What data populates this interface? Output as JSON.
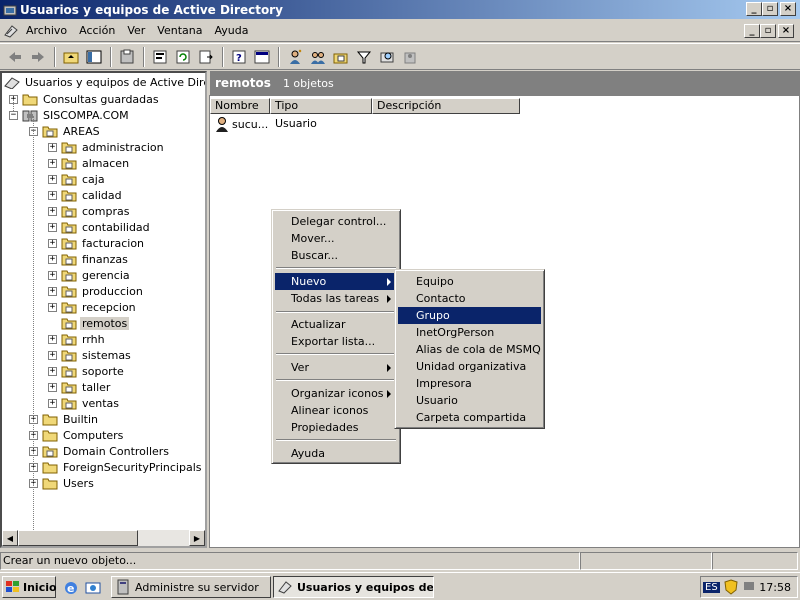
{
  "window": {
    "title": "Usuarios y equipos de Active Directory"
  },
  "menubar": {
    "items": [
      "Archivo",
      "Acción",
      "Ver",
      "Ventana",
      "Ayuda"
    ]
  },
  "toolbar": {
    "icons": [
      "back-icon",
      "forward-icon",
      "up-folder-icon",
      "show-tree-icon",
      "copy-icon",
      "properties-icon",
      "refresh-icon",
      "export-icon",
      "help-icon",
      "console-icon",
      "new-user-icon",
      "new-group-icon",
      "new-ou-icon",
      "filter-icon",
      "find-icon",
      "add-to-group-icon"
    ]
  },
  "tree": {
    "root": "Usuarios y equipos de Active Director",
    "saved_queries": "Consultas guardadas",
    "domain": "SISCOMPA.COM",
    "areas": "AREAS",
    "area_children": [
      "administracion",
      "almacen",
      "caja",
      "calidad",
      "compras",
      "contabilidad",
      "facturacion",
      "finanzas",
      "gerencia",
      "produccion",
      "recepcion",
      "remotos",
      "rrhh",
      "sistemas",
      "soporte",
      "taller",
      "ventas"
    ],
    "selected": "remotos",
    "domain_children": [
      "Builtin",
      "Computers",
      "Domain Controllers",
      "ForeignSecurityPrincipals",
      "Users"
    ]
  },
  "right_pane": {
    "header_title": "remotos",
    "header_count": "1 objetos",
    "columns": [
      "Nombre",
      "Tipo",
      "Descripción"
    ],
    "rows": [
      {
        "name": "sucu...",
        "type": "Usuario",
        "description": ""
      }
    ]
  },
  "context_menu": {
    "items": [
      "Delegar control...",
      "Mover...",
      "Buscar...",
      "Nuevo",
      "Todas las tareas",
      "Actualizar",
      "Exportar lista...",
      "Ver",
      "Organizar iconos",
      "Alinear iconos",
      "Propiedades",
      "Ayuda"
    ],
    "highlighted": "Nuevo"
  },
  "submenu": {
    "items": [
      "Equipo",
      "Contacto",
      "Grupo",
      "InetOrgPerson",
      "Alias de cola de MSMQ",
      "Unidad organizativa",
      "Impresora",
      "Usuario",
      "Carpeta compartida"
    ],
    "highlighted": "Grupo"
  },
  "statusbar": {
    "text": "Crear un nuevo objeto..."
  },
  "taskbar": {
    "start": "Inicio",
    "tasks": [
      "Administre su servidor",
      "Usuarios y equipos de..."
    ],
    "lang": "ES",
    "clock": "17:58"
  },
  "colors": {
    "title_gradient_start": "#0a246a",
    "title_gradient_end": "#a6caf0",
    "highlight": "#0a246a",
    "face": "#d4d0c8",
    "pane_header": "#808080"
  }
}
